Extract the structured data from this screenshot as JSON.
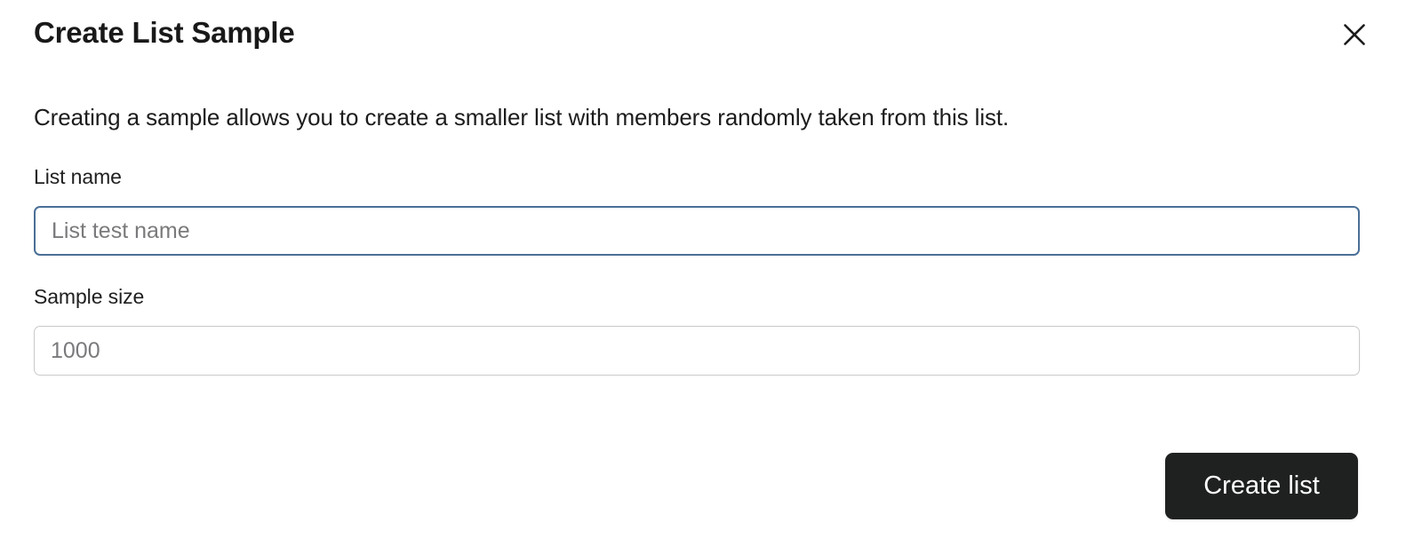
{
  "dialog": {
    "title": "Create List Sample",
    "description": "Creating a sample allows you to create a smaller list with members randomly taken from this list.",
    "close_icon": "close-icon",
    "background_color": "#ffffff"
  },
  "fields": [
    {
      "label": "List name",
      "value": "",
      "placeholder": "List test name",
      "focused": true,
      "border_color": "#4a6f96"
    },
    {
      "label": "Sample size",
      "value": "",
      "placeholder": "1000",
      "focused": false,
      "border_color": "#c9c9c9"
    }
  ],
  "footer": {
    "submit_label": "Create list",
    "submit_background": "#1f2020",
    "submit_text_color": "#ffffff"
  }
}
